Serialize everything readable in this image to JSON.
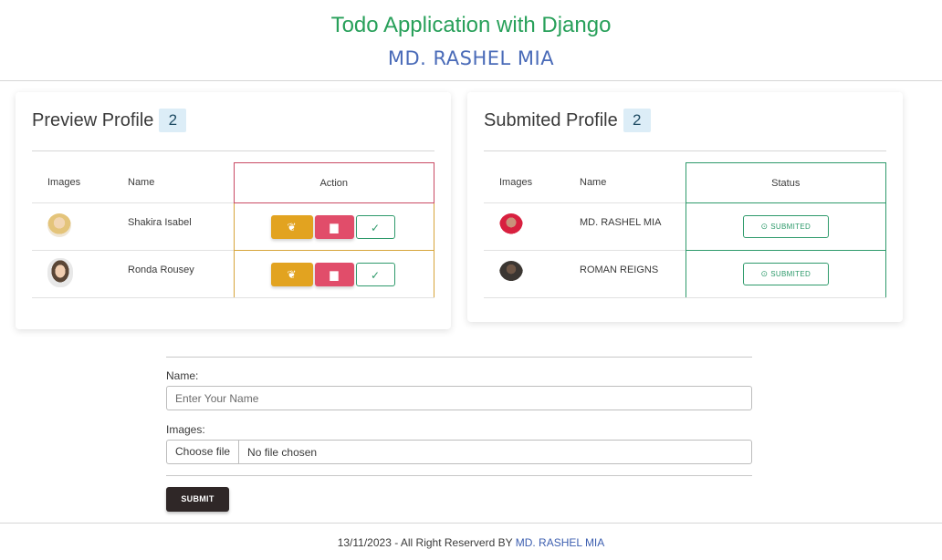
{
  "header": {
    "title": "Todo Application with Django",
    "author": "MD. RASHEL MIA",
    "title_color": "#28a05a",
    "author_color": "#4a6bb8"
  },
  "preview": {
    "title": "Preview Profile",
    "count": "2",
    "columns": [
      "Images",
      "Name",
      "Action"
    ],
    "rows": [
      {
        "name": "Shakira Isabel",
        "avatar": "woman-blonde-avatar"
      },
      {
        "name": "Ronda Rousey",
        "avatar": "woman-dark-hair-avatar"
      }
    ],
    "action_icons": {
      "edit": "leaf-icon",
      "delete": "trash-icon",
      "approve": "check-icon"
    },
    "colors": {
      "edit": "#e2a320",
      "delete": "#e14d6a",
      "approve": "#2e9a6b"
    }
  },
  "submitted": {
    "title": "Submited Profile",
    "count": "2",
    "columns": [
      "Images",
      "Name",
      "Status"
    ],
    "rows": [
      {
        "name": "MD. RASHEL MIA",
        "status": "SUBMITED",
        "avatar": "man-red-shirt-avatar"
      },
      {
        "name": "ROMAN REIGNS",
        "status": "SUBMITED",
        "avatar": "man-long-hair-avatar"
      }
    ],
    "status_icon": "check-circle-icon"
  },
  "form": {
    "name_label": "Name:",
    "name_placeholder": "Enter Your Name",
    "name_value": "",
    "images_label": "Images:",
    "file_button": "Choose file",
    "file_status": "No file chosen",
    "submit_label": "SUBMIT"
  },
  "footer": {
    "text": "13/11/2023 - All Right Reserverd BY ",
    "link": "MD. RASHEL MIA"
  }
}
